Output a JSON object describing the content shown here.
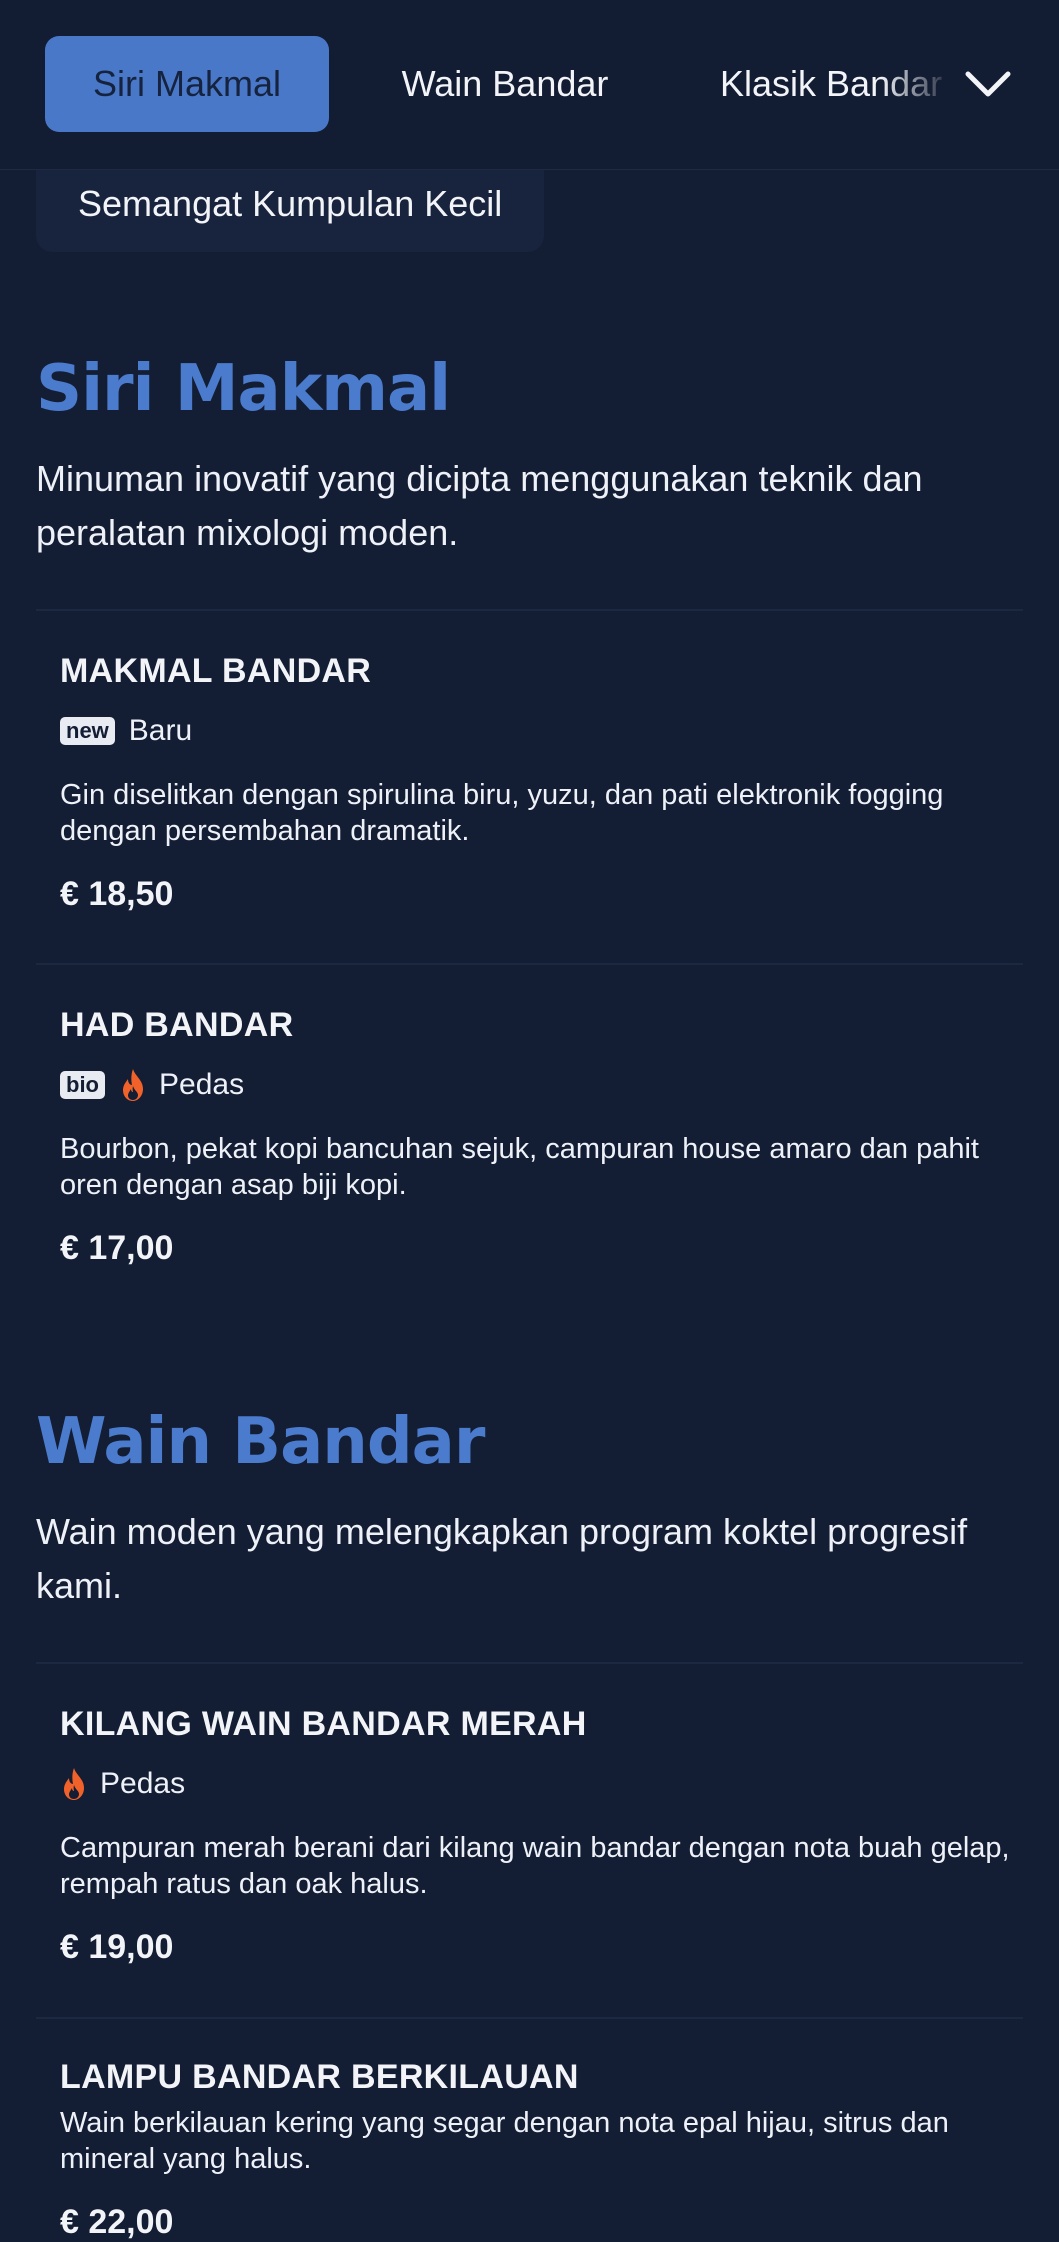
{
  "nav": {
    "tabs": [
      {
        "label": "Siri Makmal",
        "active": true
      },
      {
        "label": "Wain Bandar",
        "active": false
      },
      {
        "label": "Klasik Bandar",
        "active": false
      }
    ],
    "more_icon": "chevron-down-icon"
  },
  "filters": {
    "chip_label": "Semangat Kumpulan Kecil"
  },
  "sections": [
    {
      "title": "Siri Makmal",
      "description": "Minuman inovatif yang dicipta menggunakan teknik dan peralatan mixologi moden.",
      "items": [
        {
          "name": "MAKMAL BANDAR",
          "badge": "new",
          "tag": "Baru",
          "description": "Gin diselitkan dengan spirulina biru, yuzu, dan pati elektronik fogging dengan persembahan dramatik.",
          "price": "€ 18,50"
        },
        {
          "name": "HAD BANDAR",
          "badge": "bio",
          "tag": "Pedas",
          "description": "Bourbon, pekat kopi bancuhan sejuk, campuran house amaro dan pahit oren dengan asap biji kopi.",
          "price": "€ 17,00"
        }
      ]
    },
    {
      "title": "Wain Bandar",
      "description": "Wain moden yang melengkapkan program koktel progresif kami.",
      "items": [
        {
          "name": "KILANG WAIN BANDAR MERAH",
          "tag": "Pedas",
          "description": "Campuran merah berani dari kilang wain bandar dengan nota buah gelap, rempah ratus dan oak halus.",
          "price": "€ 19,00"
        },
        {
          "name": "LAMPU BANDAR BERKILAUAN",
          "description": "Wain berkilauan kering yang segar dengan nota epal hijau, sitrus dan mineral yang halus.",
          "price": "€ 22,00"
        }
      ]
    }
  ],
  "colors": {
    "background": "#131d33",
    "accent": "#4b7bcc",
    "active_tab": "#4a78c8",
    "spicy": "#f0622a"
  }
}
